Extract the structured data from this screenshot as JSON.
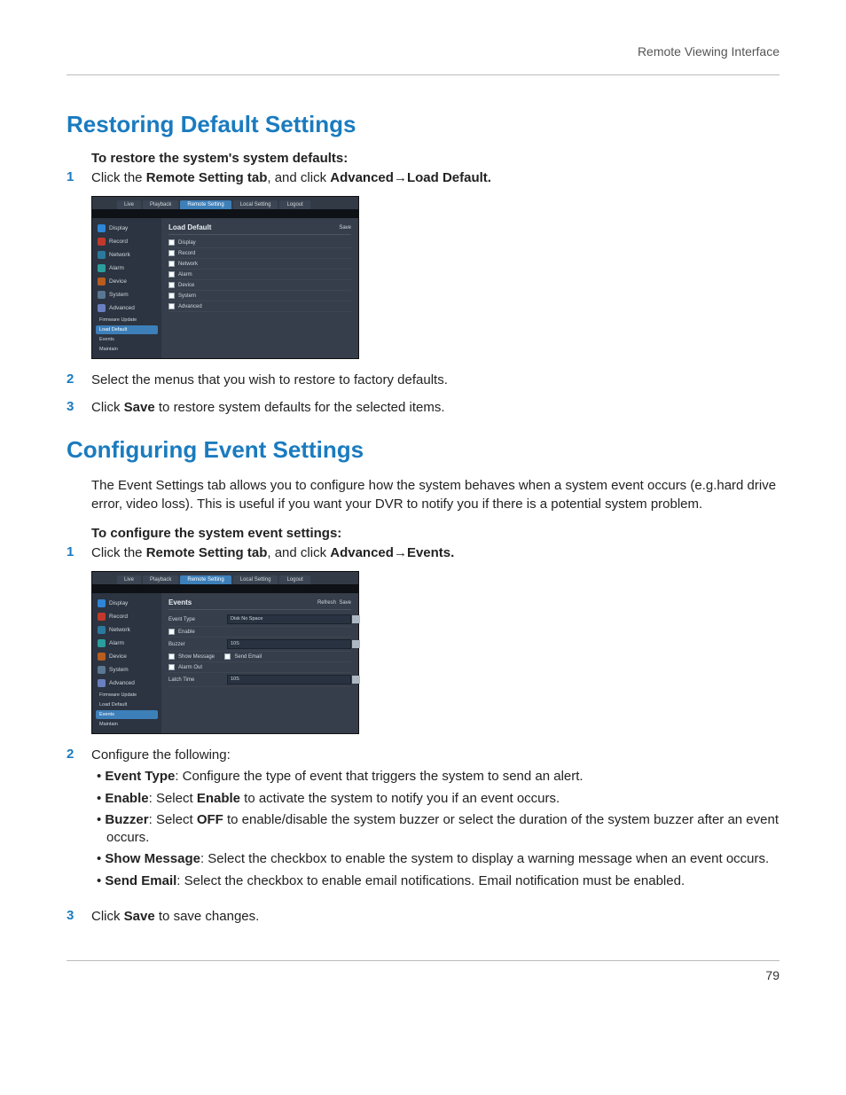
{
  "header": {
    "title": "Remote Viewing Interface"
  },
  "h1": "Restoring Default Settings",
  "sub1": "To restore the system's system defaults:",
  "s1": {
    "num": "1",
    "pre": "Click the ",
    "b1": "Remote Setting tab",
    "mid": ", and click ",
    "b2": "Advanced",
    "arrow": "→",
    "b3": "Load Default."
  },
  "shot1": {
    "tabs": {
      "live": "Live",
      "playback": "Playback",
      "remote": "Remote Setting",
      "local": "Local Setting",
      "logout": "Logout"
    },
    "side": {
      "display": "Display",
      "record": "Record",
      "network": "Network",
      "alarm": "Alarm",
      "device": "Device",
      "system": "System",
      "advanced": "Advanced",
      "sub_fw": "Firmware Update",
      "sub_load": "Load Default",
      "sub_events": "Events",
      "sub_maintain": "Maintain"
    },
    "panel": {
      "title": "Load Default",
      "save": "Save",
      "items": {
        "display": "Display",
        "record": "Record",
        "network": "Network",
        "alarm": "Alarm",
        "device": "Device",
        "system": "System",
        "advanced": "Advanced"
      }
    }
  },
  "s2": {
    "num": "2",
    "text": "Select the menus that you wish to restore to factory defaults."
  },
  "s3": {
    "num": "3",
    "pre": "Click ",
    "b": "Save",
    "post": " to restore system defaults for the selected items."
  },
  "h2": "Configuring Event Settings",
  "intro": "The Event Settings tab allows you to configure how the system behaves when a system event occurs (e.g.hard drive error, video loss). This is useful if you want your DVR to notify you if there is a potential system problem.",
  "sub2": "To configure the system event settings:",
  "e1": {
    "num": "1",
    "pre": "Click the ",
    "b1": "Remote Setting tab",
    "mid": ", and click ",
    "b2": "Advanced",
    "arrow": "→",
    "b3": "Events."
  },
  "shot2": {
    "panel": {
      "title": "Events",
      "refresh": "Refresh",
      "save": "Save",
      "evtype": "Event Type",
      "evtype_val": "Disk No Space",
      "enable": "Enable",
      "buzzer": "Buzzer",
      "buzzer_val": "10S",
      "showmsg": "Show Message",
      "sendemail": "Send Email",
      "alarmout": "Alarm Out",
      "latch": "Latch Time",
      "latch_val": "10S"
    }
  },
  "e2": {
    "num": "2",
    "text": "Configure the following:"
  },
  "bul": {
    "a_b": "Event Type",
    "a_t": ": Configure the type of event that triggers the system to send an alert.",
    "b_b": "Enable",
    "b_m": ": Select ",
    "b_b2": "Enable",
    "b_t": " to activate the system to notify you if an event occurs.",
    "c_b": "Buzzer",
    "c_m": ": Select ",
    "c_b2": "OFF",
    "c_t": " to enable/disable the system buzzer or select the duration of the system buzzer after an event occurs.",
    "d_b": "Show Message",
    "d_t": ": Select the checkbox to enable the system to display a warning message when an event occurs.",
    "e_b": "Send Email",
    "e_t": ": Select the checkbox to enable email notifications. Email notification must be enabled."
  },
  "e3": {
    "num": "3",
    "pre": "Click ",
    "b": "Save",
    "post": " to save changes."
  },
  "footer": {
    "page": "79"
  }
}
